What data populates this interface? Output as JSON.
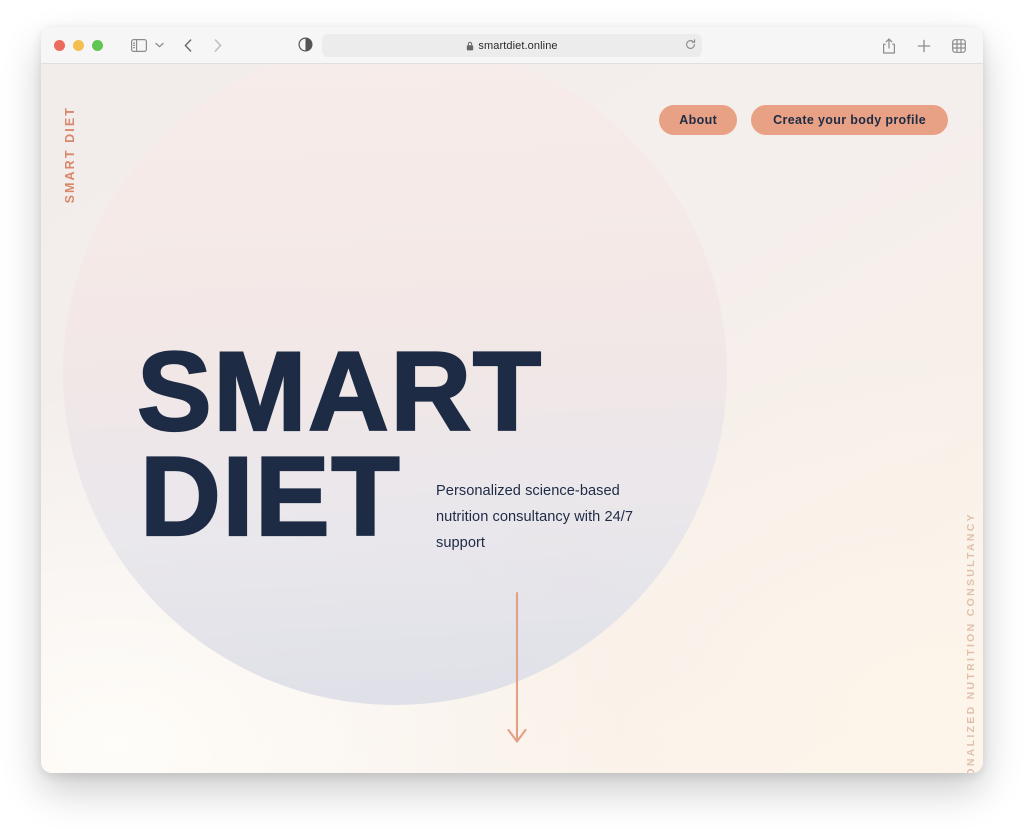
{
  "browser": {
    "url": "smartdiet.online",
    "secure_icon": "lock-icon",
    "traffic_lights": [
      "close-button",
      "minimize-button",
      "zoom-button"
    ],
    "toolbar_icons": [
      "sidebar-toggle-icon",
      "chevron-down-icon",
      "back-chevron-icon",
      "forward-chevron-icon",
      "reader-mode-icon",
      "reload-icon",
      "share-icon",
      "new-tab-icon",
      "tab-overview-icon"
    ]
  },
  "page": {
    "brand_vertical": "SMART DIET",
    "tagline_vertical": "PERSONALIZED NUTRITION CONSULTANCY",
    "nav": {
      "about_label": "About",
      "create_label": "Create your body profile"
    },
    "hero": {
      "headline_line1": "SMART",
      "headline_line2": "DIET",
      "subtitle": "Personalized science-based nutrition consultancy with 24/7 support",
      "scroll_arrow": "arrow-down-icon"
    },
    "colors": {
      "accent_salmon": "#e8a184",
      "brand_salmon": "#d9876a",
      "navy": "#1d2b45",
      "tagline_tan": "#e0c0ab",
      "background_cream": "#f4eeec",
      "circle_top": "#f7ecea",
      "circle_bottom": "#dcdee8"
    }
  }
}
